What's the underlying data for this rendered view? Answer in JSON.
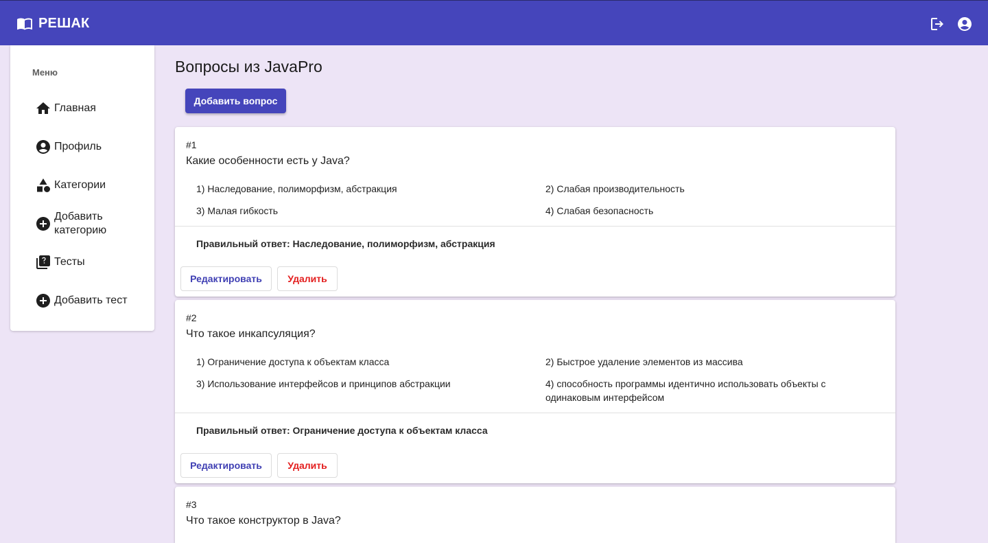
{
  "header": {
    "app_title": "РЕШАК",
    "brand_icon": "open-book-icon",
    "actions": [
      {
        "name": "logout-icon"
      },
      {
        "name": "account-circle-icon"
      }
    ],
    "color": "#4545bb"
  },
  "sidebar": {
    "title": "Меню",
    "items": [
      {
        "label": "Главная",
        "icon": "home-icon"
      },
      {
        "label": "Профиль",
        "icon": "account-circle-icon"
      },
      {
        "label": "Категории",
        "icon": "shapes-icon"
      },
      {
        "label": "Добавить категорию",
        "icon": "add-circle-icon"
      },
      {
        "label": "Тесты",
        "icon": "quiz-icon"
      },
      {
        "label": "Добавить тест",
        "icon": "add-circle-icon"
      }
    ]
  },
  "main": {
    "title": "Вопросы из JavaPro",
    "add_button": "Добавить вопрос",
    "questions": [
      {
        "number": "#1",
        "text": "Какие особенности есть у Java?",
        "options": [
          "1) Наследование, полиморфизм, абстракция",
          "2) Слабая производительность",
          "3) Малая гибкость",
          "4) Слабая безопасность"
        ],
        "answer": "Правильный ответ: Наследование, полиморфизм, абстракция",
        "edit_label": "Редактировать",
        "delete_label": "Удалить"
      },
      {
        "number": "#2",
        "text": "Что такое инкапсуляция?",
        "options": [
          "1) Ограничение доступа к объектам класса",
          "2) Быстрое удаление элементов из массива",
          "3) Использование интерфейсов и принципов абстракции",
          "4) способность программы идентично использовать объекты с одинаковым интерфейсом"
        ],
        "answer": "Правильный ответ: Ограничение доступа к объектам класса",
        "edit_label": "Редактировать",
        "delete_label": "Удалить"
      },
      {
        "number": "#3",
        "text": "Что такое конструктор в Java?"
      }
    ]
  },
  "colors": {
    "primary": "#4545bb",
    "background": "#ede4f6",
    "danger": "#e31d1d"
  }
}
